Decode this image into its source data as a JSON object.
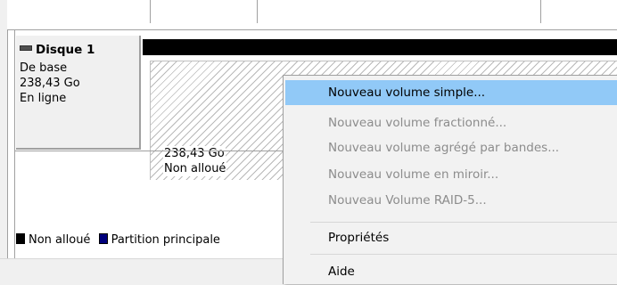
{
  "disk": {
    "title": "Disque 1",
    "type": "De base",
    "size": "238,43 Go",
    "status": "En ligne"
  },
  "volume": {
    "size": "238,43 Go",
    "status": "Non alloué"
  },
  "legend": {
    "unallocated": "Non alloué",
    "primary": "Partition principale"
  },
  "colors": {
    "unallocated": "#000000",
    "primary": "#00007c",
    "highlight": "#91c9f7"
  },
  "context_menu": {
    "items": [
      {
        "label": "Nouveau volume simple...",
        "enabled": true,
        "highlighted": true
      },
      {
        "label": "Nouveau volume fractionné...",
        "enabled": false
      },
      {
        "label": "Nouveau volume agrégé par bandes...",
        "enabled": false
      },
      {
        "label": "Nouveau volume en miroir...",
        "enabled": false
      },
      {
        "label": "Nouveau Volume RAID-5...",
        "enabled": false
      },
      {
        "label": "Propriétés",
        "enabled": true
      },
      {
        "label": "Aide",
        "enabled": true
      }
    ]
  }
}
